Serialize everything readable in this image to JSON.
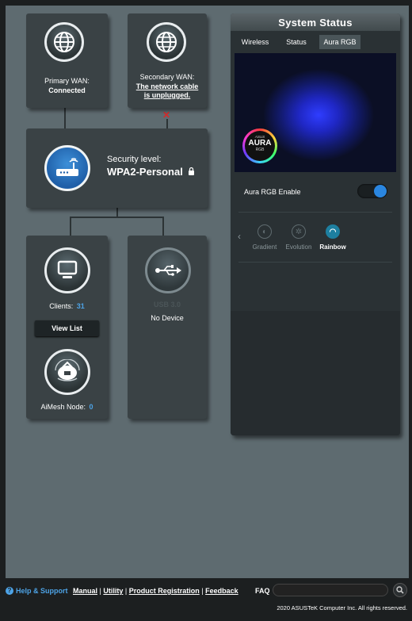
{
  "network_map": {
    "primary_wan": {
      "label": "Primary WAN:",
      "status": "Connected"
    },
    "secondary_wan": {
      "label": "Secondary WAN:",
      "status": "The network cable is unplugged."
    },
    "security": {
      "label": "Security level:",
      "value": "WPA2-Personal"
    },
    "clients": {
      "label": "Clients:",
      "count": "31",
      "button": "View List"
    },
    "usb": {
      "label": "USB 3.0",
      "status": "No Device"
    },
    "aimesh": {
      "label": "AiMesh Node:",
      "count": "0"
    }
  },
  "system_status": {
    "title": "System Status",
    "tabs": [
      "Wireless",
      "Status",
      "Aura RGB"
    ],
    "active_tab": "Aura RGB",
    "aura_logo": {
      "brand": "ASUS",
      "name": "AURA",
      "sub": "RGB"
    },
    "aura_enable_label": "Aura RGB Enable",
    "aura_enabled": true,
    "effects": [
      "Gradient",
      "Evolution",
      "Rainbow"
    ],
    "selected_effect": "Rainbow"
  },
  "footer": {
    "help_support": "Help & Support",
    "links": [
      "Manual",
      "Utility",
      "Product Registration",
      "Feedback"
    ],
    "faq_label": "FAQ",
    "faq_placeholder": "",
    "copyright": "2020 ASUSTeK Computer Inc. All rights reserved."
  },
  "colors": {
    "accent": "#2a86e0",
    "count_blue": "#4da3e6",
    "disconnect_red": "#d62a2a",
    "background": "#5e6b70"
  }
}
